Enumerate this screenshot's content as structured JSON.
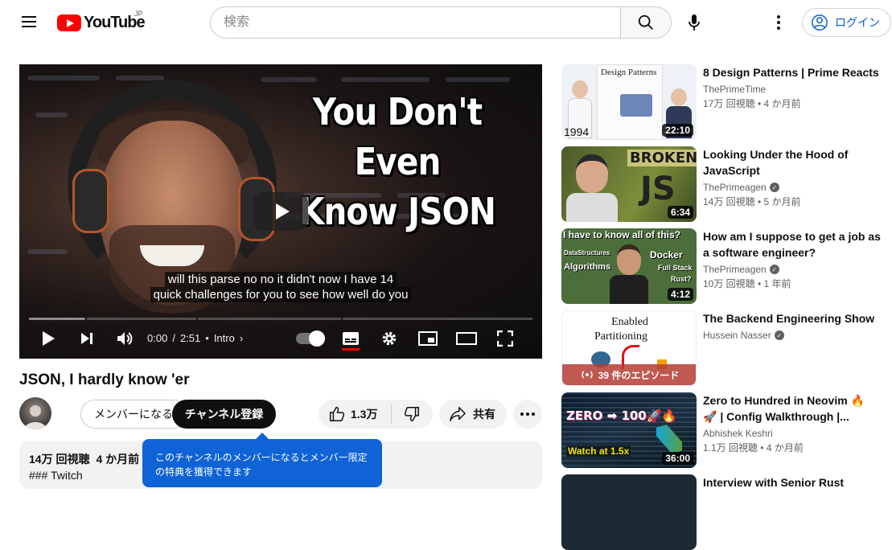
{
  "header": {
    "region": "JP",
    "logo_text": "YouTube",
    "search_placeholder": "検索",
    "login_label": "ログイン"
  },
  "player": {
    "thumbnail_title_line1": "You Don't Even",
    "thumbnail_title_line2": "Know JSON",
    "caption_line1": "will this parse no no it didn't now I have 14",
    "caption_line2": "quick challenges for you to see how well do you",
    "current_time": "0:00",
    "duration": "2:51",
    "chapter": "Intro",
    "progress": 0,
    "loaded_fraction": 0.11
  },
  "video": {
    "title": "JSON, I hardly know 'er",
    "member_label": "メンバーになる",
    "subscribe_label": "チャンネル登録",
    "likes": "1.3万",
    "share_label": "共有",
    "views": "14万 回視聴",
    "age": "4 か月前",
    "description_line1": "### Twitch",
    "tooltip_line1": "このチャンネルのメンバーになるとメンバー限定",
    "tooltip_line2": "の特典を獲得できます"
  },
  "sidebar": [
    {
      "title": "8 Design Patterns | Prime Reacts",
      "channel": "ThePrimeTime",
      "verified": false,
      "meta": "17万 回視聴 • 4 か月前",
      "duration": "22:10",
      "thumb_text": "Design Patterns",
      "thumb_year": "1994"
    },
    {
      "title": "Looking Under the Hood of JavaScript",
      "channel": "ThePrimeagen",
      "verified": true,
      "meta": "14万 回視聴 • 5 か月前",
      "duration": "6:34",
      "thumb_text": "BROKEN",
      "thumb_logo": "JS"
    },
    {
      "title": "How am I suppose to get a job as a software engineer?",
      "channel": "ThePrimeagen",
      "verified": true,
      "meta": "10万 回視聴 • 1 年前",
      "duration": "4:12",
      "thumb_text": "I have to know all of this?",
      "thumb_tags": [
        "DataStructures",
        "Algorithms",
        "Docker",
        "Full Stack",
        "Rust?"
      ]
    },
    {
      "title": "The Backend Engineering Show",
      "channel": "Hussein Nasser",
      "verified": true,
      "meta": "",
      "playlist_label": "39 件のエピソード",
      "thumb_text_1": "Enabled",
      "thumb_text_2": "Partitioning"
    },
    {
      "title": "Zero to Hundred in Neovim 🔥 🚀 | Config Walkthrough |...",
      "channel": "Abhishek Keshri",
      "verified": false,
      "meta": "1.1万 回視聴 • 4 か月前",
      "duration": "36:00",
      "thumb_text": "ZERO ➡ 100🚀🔥",
      "thumb_sub": "Watch at 1.5x"
    },
    {
      "title": "Interview with Senior Rust",
      "channel": "",
      "verified": false,
      "meta": ""
    }
  ]
}
